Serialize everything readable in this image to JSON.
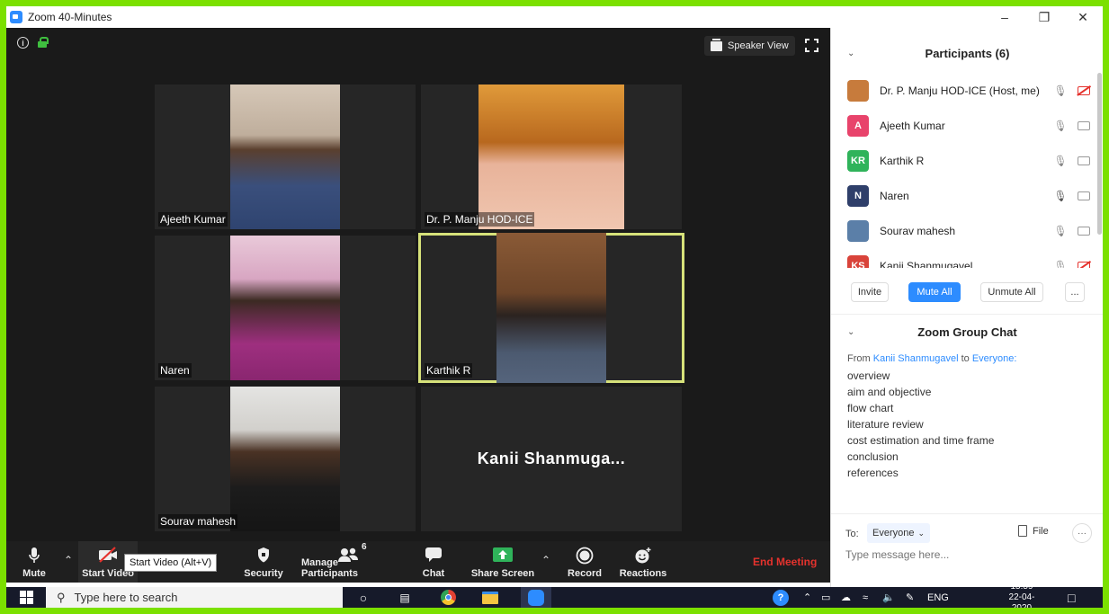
{
  "window": {
    "title": "Zoom 40-Minutes",
    "controls": [
      "minimize-icon",
      "restore-icon",
      "close-icon"
    ]
  },
  "video": {
    "speaker_view_label": "Speaker View",
    "tiles": [
      {
        "name": "Ajeeth Kumar",
        "has_video": true
      },
      {
        "name": "Dr. P. Manju HOD-ICE",
        "has_video": true
      },
      {
        "name": "Naren",
        "has_video": true
      },
      {
        "name": "Karthik R",
        "has_video": true,
        "active_speaker": true
      },
      {
        "name": "Sourav mahesh",
        "has_video": true
      },
      {
        "name": "Kanii  Shanmuga...",
        "has_video": false
      }
    ]
  },
  "toolbar": {
    "mute_label": "Mute",
    "start_video_label": "Start Video",
    "tooltip": "Start Video (Alt+V)",
    "security_label": "Security",
    "manage_participants_label": "Manage Participants",
    "participant_count": "6",
    "chat_label": "Chat",
    "share_screen_label": "Share Screen",
    "record_label": "Record",
    "reactions_label": "Reactions",
    "end_meeting_label": "End Meeting"
  },
  "participants_panel": {
    "title": "Participants (6)",
    "participants": [
      {
        "name": "Dr. P. Manju HOD-ICE (Host, me)",
        "avatar": "photo",
        "avatar_color": "#c77b3c",
        "initials": "",
        "mic": "muted",
        "video": "off"
      },
      {
        "name": "Ajeeth Kumar",
        "avatar": "initials",
        "avatar_color": "#e8436b",
        "initials": "A",
        "mic": "muted",
        "video": "on"
      },
      {
        "name": "Karthik R",
        "avatar": "initials",
        "avatar_color": "#2fb35a",
        "initials": "KR",
        "mic": "muted",
        "video": "on"
      },
      {
        "name": "Naren",
        "avatar": "initials",
        "avatar_color": "#2f3f6a",
        "initials": "N",
        "mic": "unmuted",
        "video": "on"
      },
      {
        "name": "Sourav mahesh",
        "avatar": "photo",
        "avatar_color": "#5b7fa8",
        "initials": "",
        "mic": "muted",
        "video": "on"
      },
      {
        "name": "Kanii Shanmugavel",
        "avatar": "initials",
        "avatar_color": "#d9433a",
        "initials": "KS",
        "mic": "muted",
        "video": "off"
      }
    ],
    "invite_label": "Invite",
    "mute_all_label": "Mute All",
    "unmute_all_label": "Unmute All",
    "more_label": "..."
  },
  "chat_panel": {
    "title": "Zoom Group Chat",
    "from_prefix": "From",
    "from_name": "Kanii Shanmugavel",
    "to_word": "to",
    "to_name": "Everyone:",
    "messages": [
      "overview",
      "aim and objective",
      "flow chart",
      "literature review",
      "cost estimation and time frame",
      "conclusion",
      "references"
    ],
    "to_label": "To:",
    "recipient": "Everyone",
    "file_label": "File",
    "input_placeholder": "Type message here..."
  },
  "taskbar": {
    "search_placeholder": "Type here to search",
    "language": "ENG",
    "time": "15:59",
    "date": "22-04-2020"
  },
  "colors": {
    "accent": "#2d8cff",
    "end_meeting": "#e5322d",
    "active_speaker_border": "#d7e27a",
    "screen_border": "#7be000"
  }
}
